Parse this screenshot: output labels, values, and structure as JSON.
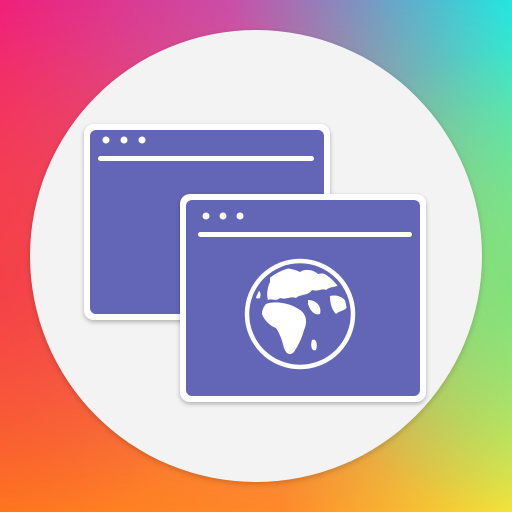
{
  "icon": {
    "name": "multiple-browser-windows-globe",
    "colors": {
      "gradient_top_left": "#f0207a",
      "gradient_top_right": "#22e6e0",
      "gradient_bottom_left": "#ff7a1a",
      "gradient_bottom_right": "#f2e43a",
      "circle": "#f4f3f4",
      "window_fill": "#6366b6",
      "window_border": "#ffffff",
      "line": "#ffffff"
    },
    "windows": [
      {
        "name": "back-window",
        "dots": 3,
        "has_globe": false
      },
      {
        "name": "front-window",
        "dots": 3,
        "has_globe": true
      }
    ]
  }
}
